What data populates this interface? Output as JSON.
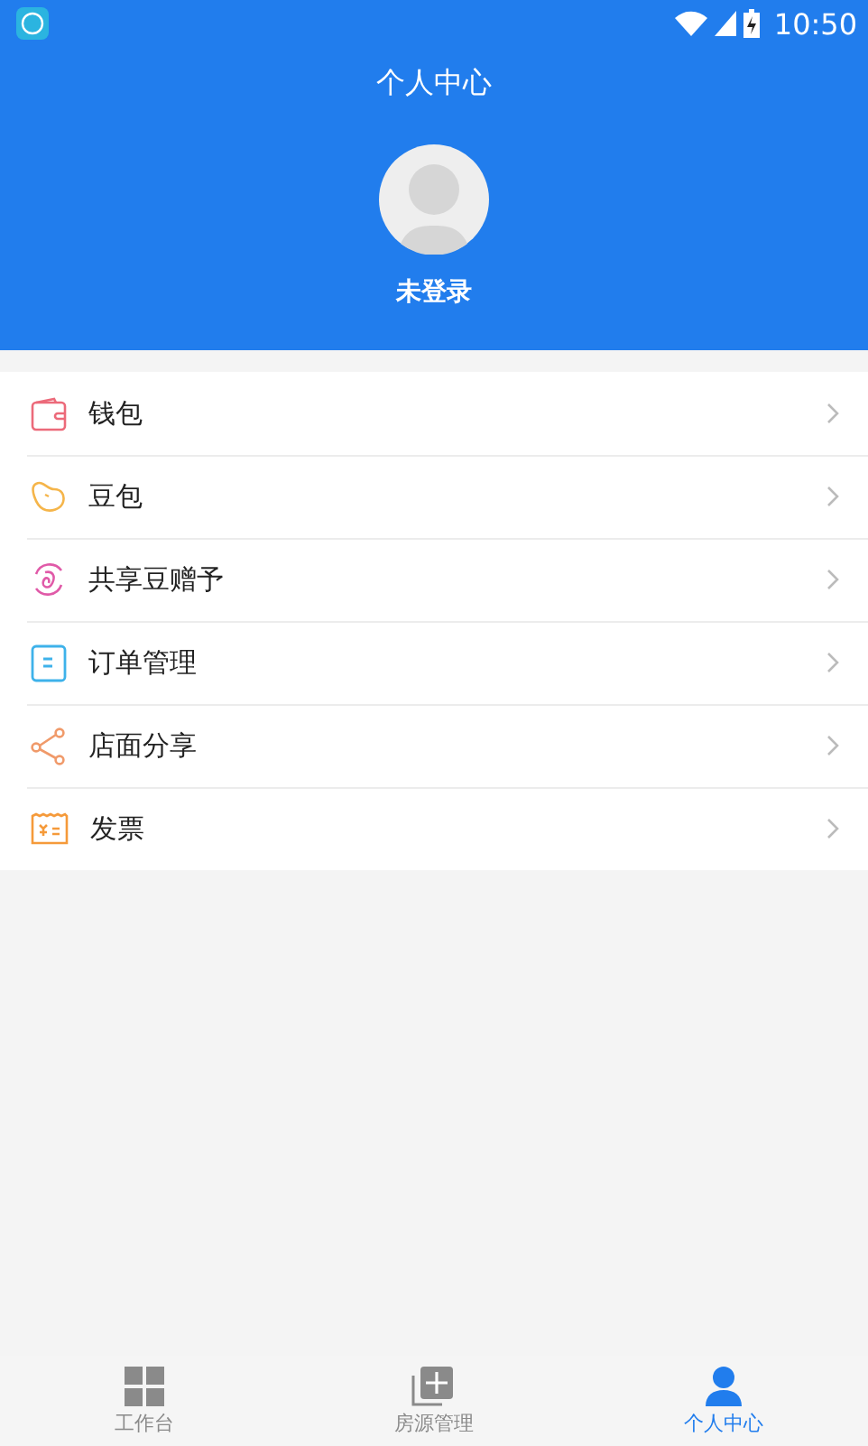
{
  "status_bar": {
    "time": "10:50"
  },
  "header": {
    "title": "个人中心",
    "user_name": "未登录"
  },
  "menu": [
    {
      "kind": "wallet",
      "label": "钱包"
    },
    {
      "kind": "bean",
      "label": "豆包"
    },
    {
      "kind": "gift",
      "label": "共享豆赠予"
    },
    {
      "kind": "order",
      "label": "订单管理"
    },
    {
      "kind": "share",
      "label": "店面分享"
    },
    {
      "kind": "invoice",
      "label": "发票"
    }
  ],
  "tab_bar": [
    {
      "kind": "grid",
      "label": "工作台",
      "selected": false
    },
    {
      "kind": "add",
      "label": "房源管理",
      "selected": false
    },
    {
      "kind": "person",
      "label": "个人中心",
      "selected": true
    }
  ]
}
